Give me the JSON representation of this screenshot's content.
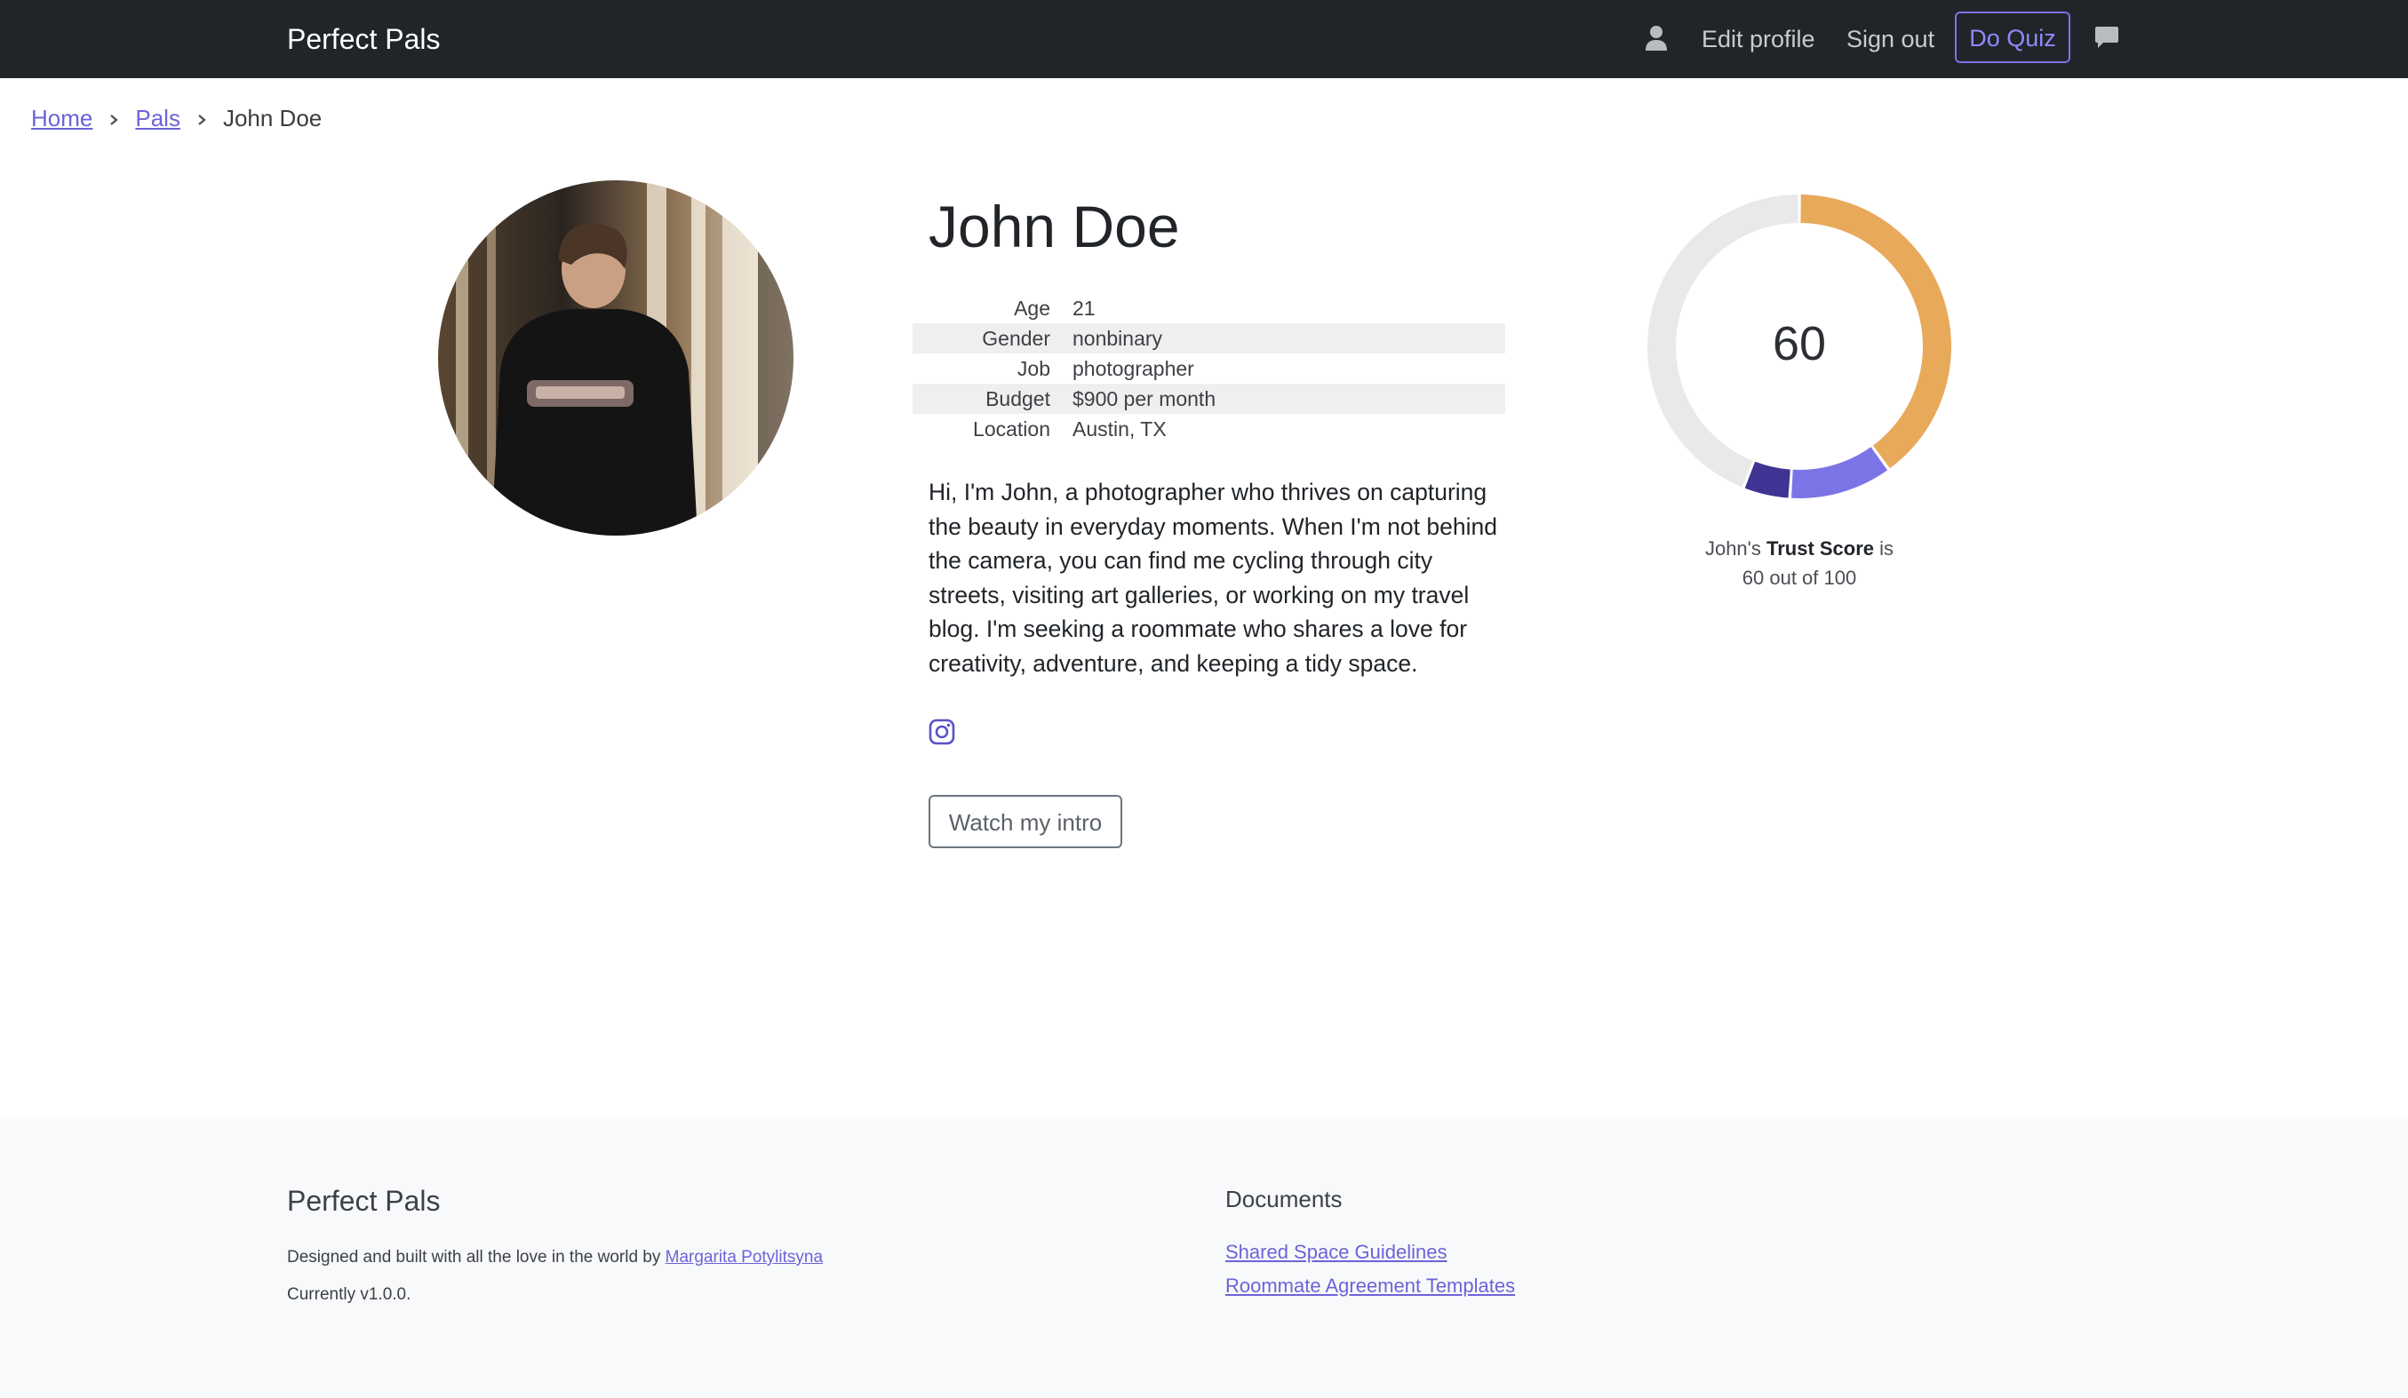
{
  "navbar": {
    "brand": "Perfect Pals",
    "user_icon": "person-icon",
    "edit_profile": "Edit profile",
    "sign_out": "Sign out",
    "do_quiz": "Do Quiz",
    "chat_icon": "chat-bubble-icon",
    "accent_color": "#7b74e6"
  },
  "breadcrumb": {
    "items": [
      "Home",
      "Pals"
    ],
    "current": "John Doe"
  },
  "profile": {
    "avatar_icon": "profile-photo",
    "name": "John Doe",
    "details": [
      {
        "label": "Age",
        "value": "21"
      },
      {
        "label": "Gender",
        "value": "nonbinary"
      },
      {
        "label": "Job",
        "value": "photographer"
      },
      {
        "label": "Budget",
        "value": "$900 per month"
      },
      {
        "label": "Location",
        "value": "Austin, TX"
      }
    ],
    "bio": "Hi, I'm John, a photographer who thrives on capturing the beauty in everyday moments. When I'm not behind the camera, you can find me cycling through city streets, visiting art galleries, or working on my travel blog. I'm seeking a roommate who shares a love for creativity, adventure, and keeping a tidy space.",
    "social_icon": "instagram-icon",
    "intro_button": "Watch my intro"
  },
  "trust": {
    "score": "60",
    "caption_prefix": "John's",
    "caption_bold": "Trust Score",
    "caption_suffix": "is",
    "caption_line2": "60 out of 100",
    "segment_colors": [
      "#e8a95a",
      "#7b74e6",
      "#3f3393",
      "#e9e9e9"
    ],
    "segment_values": [
      40,
      11,
      5,
      44
    ]
  },
  "footer": {
    "brand": "Perfect Pals",
    "credit_text": "Designed and built with all the love in the world by",
    "credit_author": "Margarita Potylitsyna",
    "version": "Currently v1.0.0.",
    "docs_title": "Documents",
    "docs_links": [
      "Shared Space Guidelines",
      "Roommate Agreement Templates"
    ]
  }
}
